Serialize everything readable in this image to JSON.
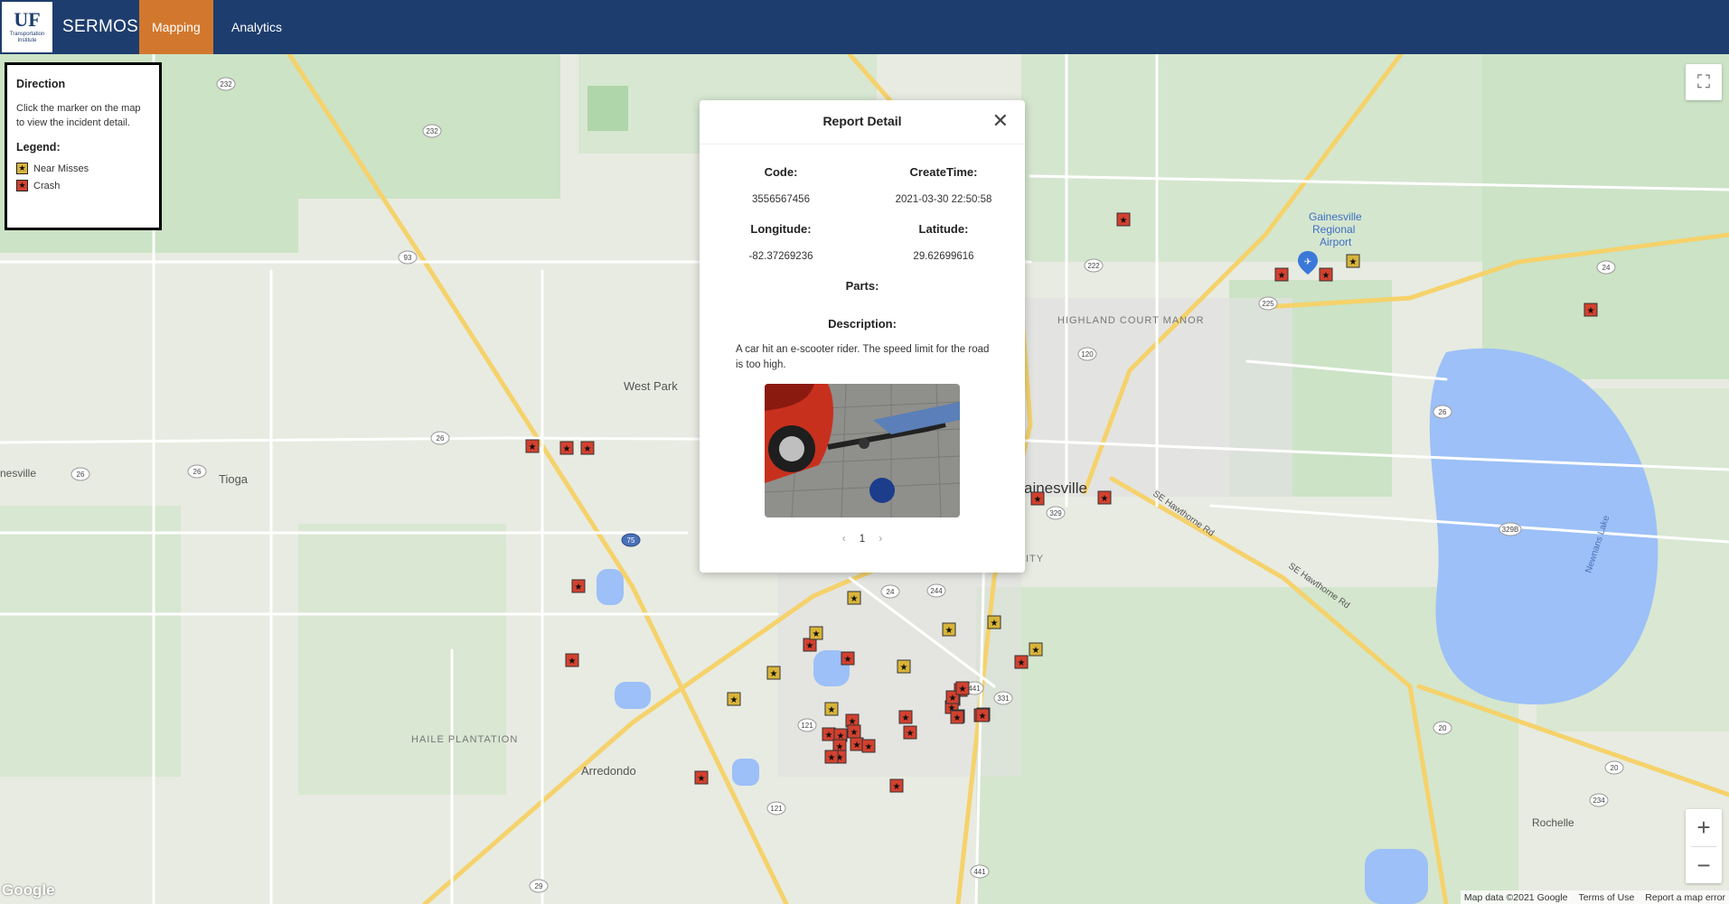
{
  "header": {
    "logo_mark": "UF",
    "logo_sub": "Transportation Institute",
    "brand": "SERMOS",
    "tabs": [
      {
        "label": "Mapping",
        "active": true
      },
      {
        "label": "Analytics",
        "active": false
      }
    ]
  },
  "legend_panel": {
    "title": "Direction",
    "instruction": "Click the marker on the map to view the incident detail.",
    "legend_heading": "Legend:",
    "items": [
      {
        "label": "Near Misses",
        "color": "#d8b43a",
        "glyph": "★"
      },
      {
        "label": "Crash",
        "color": "#d3412f",
        "glyph": "★"
      }
    ]
  },
  "report": {
    "title": "Report Detail",
    "close_icon": "close-icon",
    "code_label": "Code:",
    "code_value": "3556567456",
    "createtime_label": "CreateTime:",
    "createtime_value": "2021-03-30 22:50:58",
    "longitude_label": "Longitude:",
    "longitude_value": "-82.37269236",
    "latitude_label": "Latitude:",
    "latitude_value": "29.62699616",
    "parts_label": "Parts:",
    "description_label": "Description:",
    "description": "A car hit an e-scooter rider. The speed limit for the road is too high.",
    "page": "1"
  },
  "map": {
    "labels": {
      "west_park": "West Park",
      "tioga": "Tioga",
      "gainesville_left": "nesville",
      "gainesville": "ainesville",
      "airport": "Gainesville Regional Airport",
      "highland": "HIGHLAND COURT MANOR",
      "haile": "HAILE PLANTATION",
      "arredondo": "Arredondo",
      "rochelle": "Rochelle",
      "university": "ITY",
      "hawthorne1": "SE Hawthorne Rd",
      "hawthorne2": "SE Hawthorne Rd",
      "newnans": "Newnans Lake"
    },
    "shields": [
      "232",
      "232",
      "93",
      "26",
      "26",
      "26",
      "222",
      "120",
      "329",
      "24",
      "244",
      "441",
      "331",
      "121",
      "121",
      "75",
      "20",
      "20",
      "26",
      "225",
      "234",
      "329B",
      "441",
      "29",
      "24"
    ],
    "controls": {
      "fullscreen_icon": "fullscreen-icon",
      "zoom_in": "+",
      "zoom_out": "−"
    },
    "google": "Google",
    "attribution": [
      "Map data ©2021 Google",
      "Terms of Use",
      "Report a map error"
    ]
  }
}
